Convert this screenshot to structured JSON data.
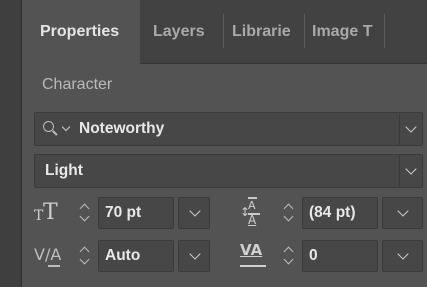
{
  "tabs": [
    {
      "label": "Properties",
      "active": true
    },
    {
      "label": "Layers",
      "active": false
    },
    {
      "label": "Librarie",
      "active": false
    },
    {
      "label": "Image T",
      "active": false
    }
  ],
  "section": {
    "title": "Character"
  },
  "font_family": {
    "value": "Noteworthy",
    "icon": "search-dropdown-icon"
  },
  "font_style": {
    "value": "Light"
  },
  "font_size": {
    "value": "70 pt",
    "icon": "font-size-icon"
  },
  "leading": {
    "value": "(84 pt)",
    "icon": "leading-icon"
  },
  "kerning": {
    "value": "Auto",
    "icon": "kerning-icon"
  },
  "tracking": {
    "value": "0",
    "icon": "tracking-icon"
  },
  "colors": {
    "panel": "#535353",
    "field": "#474747",
    "tabbar": "#424242",
    "text": "#e8e8e8"
  }
}
